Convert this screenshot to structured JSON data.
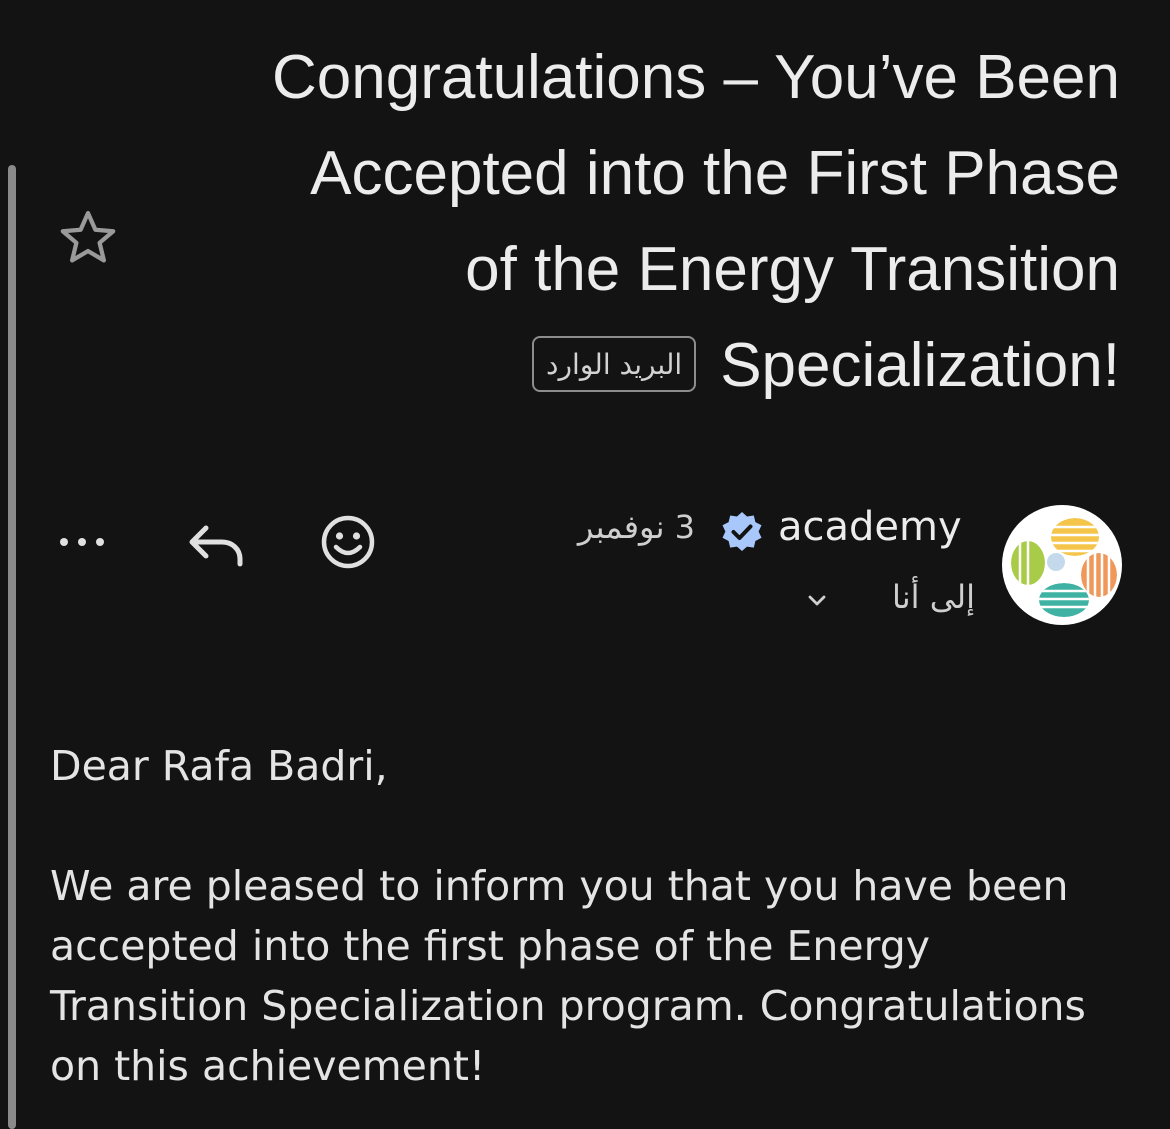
{
  "email": {
    "subject_lines": [
      "Congratulations – You’ve Been",
      "Accepted into the First Phase",
      "of the Energy Transition",
      "Specialization!"
    ],
    "label_chip": "البريد الوارد",
    "sender": {
      "name": "academy",
      "verified": true,
      "verified_icon": "verified-badge-icon",
      "avatar_icon": "academy-logo"
    },
    "date": "3 نوفمبر",
    "recipient": "إلى أنا",
    "actions": {
      "more_icon": "more-horizontal-icon",
      "reply_icon": "reply-icon",
      "emoji_icon": "emoji-reaction-icon",
      "star_icon": "star-outline-icon",
      "details_icon": "chevron-down-icon"
    },
    "body": {
      "greeting": "Dear Rafa Badri,",
      "paragraph": "We are pleased to inform you that you have been accepted into the first phase of the Energy Transition Specialization program. Congratulations on this achievement!"
    }
  },
  "colors": {
    "background": "#131313",
    "text": "#ececec",
    "verified": "#a8c7fa",
    "chip_border": "#8d8d8d"
  }
}
